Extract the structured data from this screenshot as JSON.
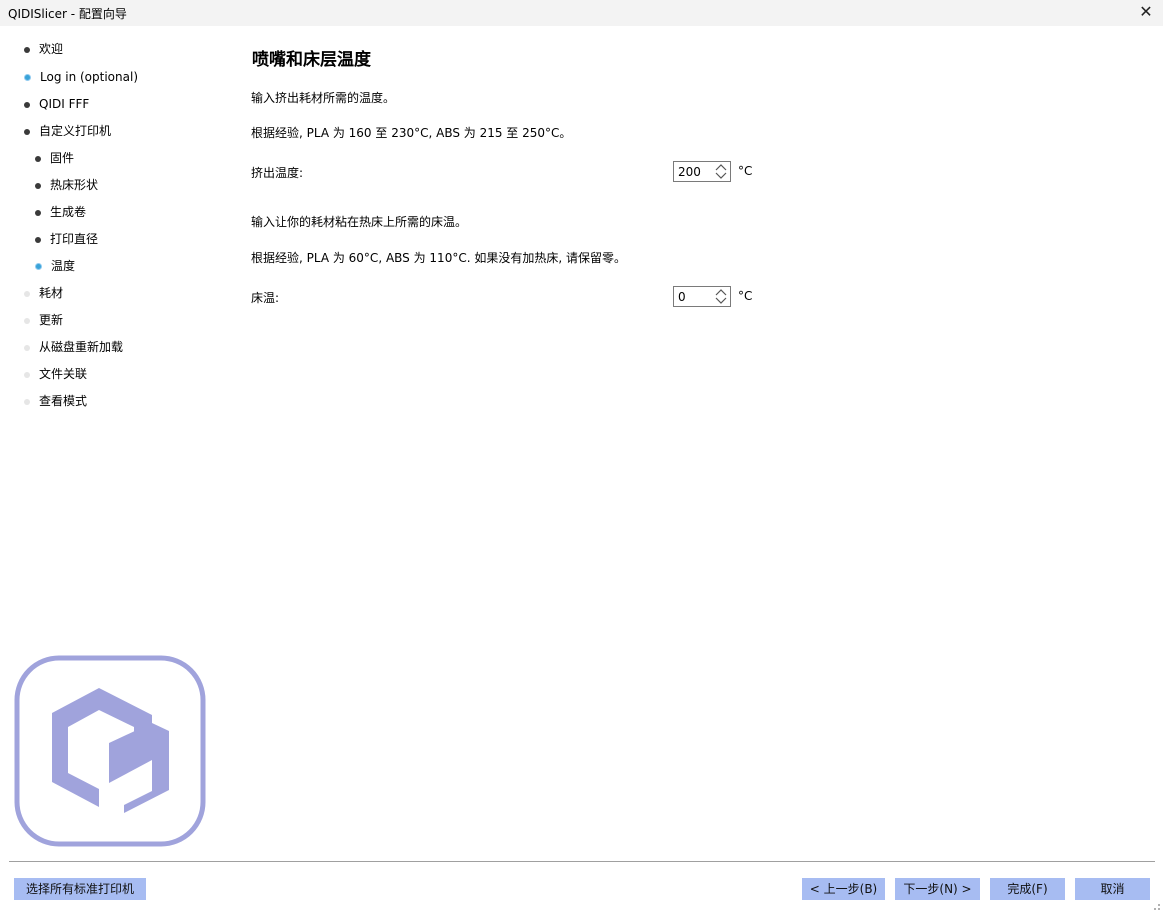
{
  "window": {
    "title": "QIDISlicer - 配置向导",
    "close_glyph": "✕"
  },
  "sidebar": {
    "items": [
      {
        "label": "欢迎",
        "state": "active",
        "level": 0
      },
      {
        "label": "Log in (optional)",
        "state": "current",
        "level": 0
      },
      {
        "label": "QIDI FFF",
        "state": "active",
        "level": 0
      },
      {
        "label": "自定义打印机",
        "state": "active",
        "level": 0
      },
      {
        "label": "固件",
        "state": "active",
        "level": 1
      },
      {
        "label": "热床形状",
        "state": "active",
        "level": 1
      },
      {
        "label": "生成卷",
        "state": "active",
        "level": 1
      },
      {
        "label": "打印直径",
        "state": "active",
        "level": 1
      },
      {
        "label": "温度",
        "state": "current",
        "level": 1
      },
      {
        "label": "耗材",
        "state": "future",
        "level": 0
      },
      {
        "label": "更新",
        "state": "future",
        "level": 0
      },
      {
        "label": "从磁盘重新加载",
        "state": "future",
        "level": 0
      },
      {
        "label": "文件关联",
        "state": "future",
        "level": 0
      },
      {
        "label": "查看模式",
        "state": "future",
        "level": 0
      }
    ]
  },
  "main": {
    "title": "喷嘴和床层温度",
    "extrusion_intro": "输入挤出耗材所需的温度。",
    "extrusion_hint": "根据经验, PLA 为 160 至 230°C, ABS 为 215 至 250°C。",
    "extrusion_label": "挤出温度:",
    "extrusion_value": "200",
    "unit": "°C",
    "bed_intro": "输入让你的耗材粘在热床上所需的床温。",
    "bed_hint": "根据经验, PLA 为 60°C, ABS 为 110°C. 如果没有加热床, 请保留零。",
    "bed_label": "床温:",
    "bed_value": "0"
  },
  "footer": {
    "select_all_label": "选择所有标准打印机",
    "back_label": "< 上一步(B)",
    "next_label": "下一步(N) >",
    "finish_label": "完成(F)",
    "cancel_label": "取消"
  },
  "colors": {
    "button_bg": "#a7bcf2",
    "logo": "#a0a3dc",
    "bullet_current": "#3aa3d8"
  }
}
